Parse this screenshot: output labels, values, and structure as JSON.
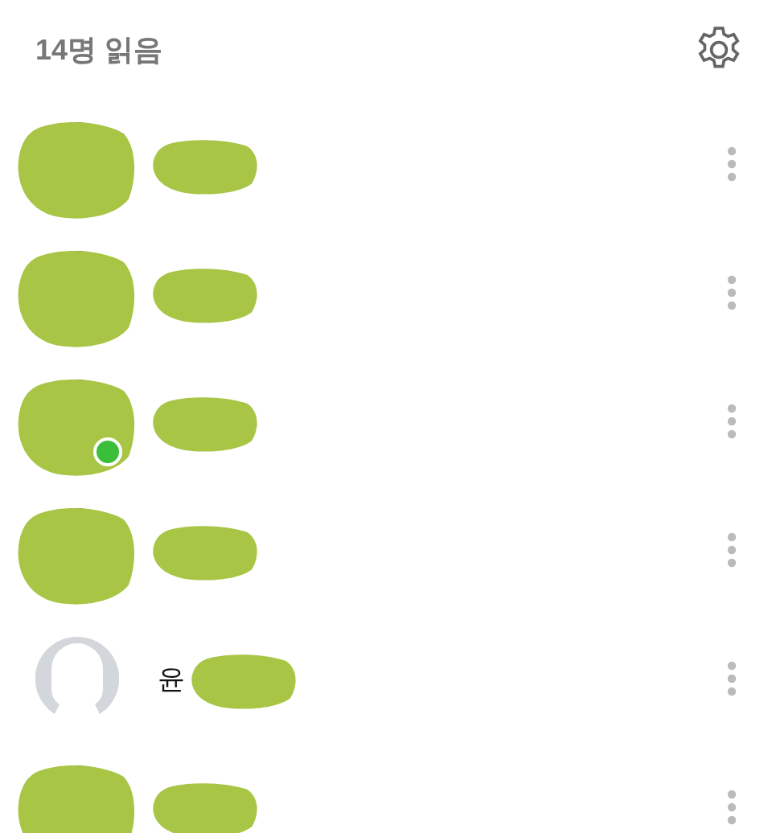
{
  "header": {
    "title": "14명 읽음"
  },
  "members": [
    {
      "kind": "redacted",
      "online": false
    },
    {
      "kind": "redacted",
      "online": false
    },
    {
      "kind": "redacted",
      "online": true
    },
    {
      "kind": "redacted",
      "online": false
    },
    {
      "kind": "default",
      "online": false,
      "name": "윤"
    },
    {
      "kind": "redacted",
      "online": false
    }
  ]
}
